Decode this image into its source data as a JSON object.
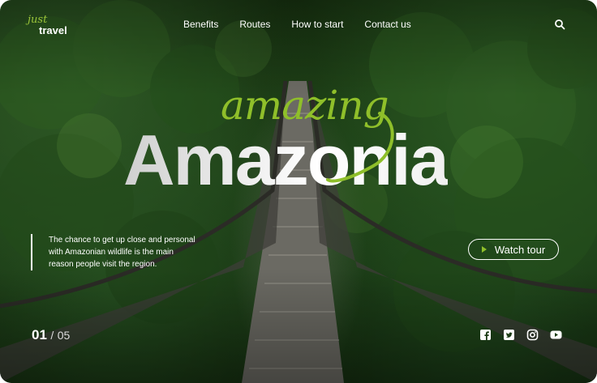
{
  "brand": {
    "script": "just",
    "word": "travel"
  },
  "nav": {
    "items": [
      {
        "label": "Benefits"
      },
      {
        "label": "Routes"
      },
      {
        "label": "How to start"
      },
      {
        "label": "Contact us"
      }
    ],
    "search_icon": "search-icon"
  },
  "hero": {
    "script": "amazing",
    "title": "Amazonia",
    "description": [
      "The chance to get up close and personal",
      "with Amazonian wildlife is the main",
      "reason people visit the region."
    ]
  },
  "watch_tour": {
    "label": "Watch tour",
    "icon": "play-icon"
  },
  "pager": {
    "current": "01",
    "separator": "/",
    "total": "05"
  },
  "social": [
    "facebook-icon",
    "twitter-icon",
    "instagram-icon",
    "youtube-icon"
  ],
  "colors": {
    "accent": "#8fbf2a",
    "forest": "#1a3a14",
    "text": "#ffffff"
  }
}
